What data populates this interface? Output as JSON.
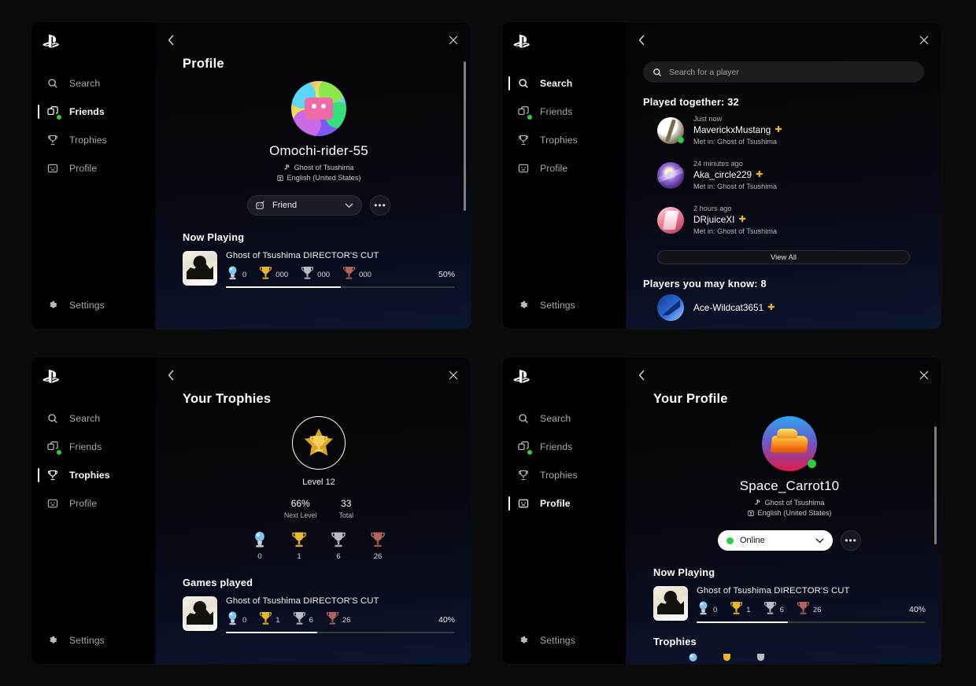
{
  "sidebar": {
    "items": [
      {
        "label": "Search",
        "icon": "search-icon"
      },
      {
        "label": "Friends",
        "icon": "friends-icon"
      },
      {
        "label": "Trophies",
        "icon": "trophy-icon"
      },
      {
        "label": "Profile",
        "icon": "profile-icon"
      }
    ],
    "settings_label": "Settings"
  },
  "panel1": {
    "title": "Profile",
    "username": "Omochi-rider-55",
    "game_meta": "Ghost of Tsushima",
    "language_meta": "English (United States)",
    "status_label": "Friend",
    "more_label": "•••",
    "now_playing_title": "Now Playing",
    "game": {
      "name": "Ghost of Tsushima DIRECTOR'S CUT",
      "platinum": "0",
      "gold": "000",
      "silver": "000",
      "bronze": "000",
      "percent": "50%",
      "progress": 50
    }
  },
  "panel2": {
    "search_placeholder": "Search for a player",
    "search_value": "",
    "played_together_heading": "Played together: 32",
    "players": [
      {
        "time": "Just now",
        "name": "MaverickxMustang",
        "met": "Met in: Ghost of Tsushima",
        "plus": "✚",
        "online": true
      },
      {
        "time": "24 minutes ago",
        "name": "Aka_circle229",
        "met": "Met in: Ghost of Tsushima",
        "plus": "✚",
        "online": false
      },
      {
        "time": "2 hours ago",
        "name": "DRjuiceXI",
        "met": "Met in: Ghost of Tsushima",
        "plus": "✚",
        "online": false
      }
    ],
    "view_all_label": "View All",
    "may_know_heading": "Players you may know: 8",
    "may_know": [
      {
        "name": "Ace-Wildcat3651",
        "plus": "✚"
      }
    ]
  },
  "panel3": {
    "title": "Your Trophies",
    "level_label": "Level 12",
    "stats": [
      {
        "value": "66%",
        "key": "Next Level"
      },
      {
        "value": "33",
        "key": "Total"
      }
    ],
    "trophies": [
      {
        "type": "platinum",
        "value": "0"
      },
      {
        "type": "gold",
        "value": "1"
      },
      {
        "type": "silver",
        "value": "6"
      },
      {
        "type": "bronze",
        "value": "26"
      }
    ],
    "games_played_title": "Games played",
    "game": {
      "name": "Ghost of Tsushima DIRECTOR'S CUT",
      "platinum": "0",
      "gold": "1",
      "silver": "6",
      "bronze": "26",
      "percent": "40%",
      "progress": 40
    }
  },
  "panel4": {
    "title": "Your Profile",
    "username": "Space_Carrot10",
    "game_meta": "Ghost of Tsushima",
    "language_meta": "English (United States)",
    "status_label": "Online",
    "more_label": "•••",
    "now_playing_title": "Now Playing",
    "game": {
      "name": "Ghost of Tsushima DIRECTOR'S CUT",
      "platinum": "0",
      "gold": "1",
      "silver": "6",
      "bronze": "26",
      "percent": "40%",
      "progress": 40
    },
    "trophies_title": "Trophies"
  },
  "colors": {
    "accent_online": "#2ecc45",
    "plus_gold": "#f0b429",
    "background": "#0a0a0a",
    "panel": "#070707"
  }
}
